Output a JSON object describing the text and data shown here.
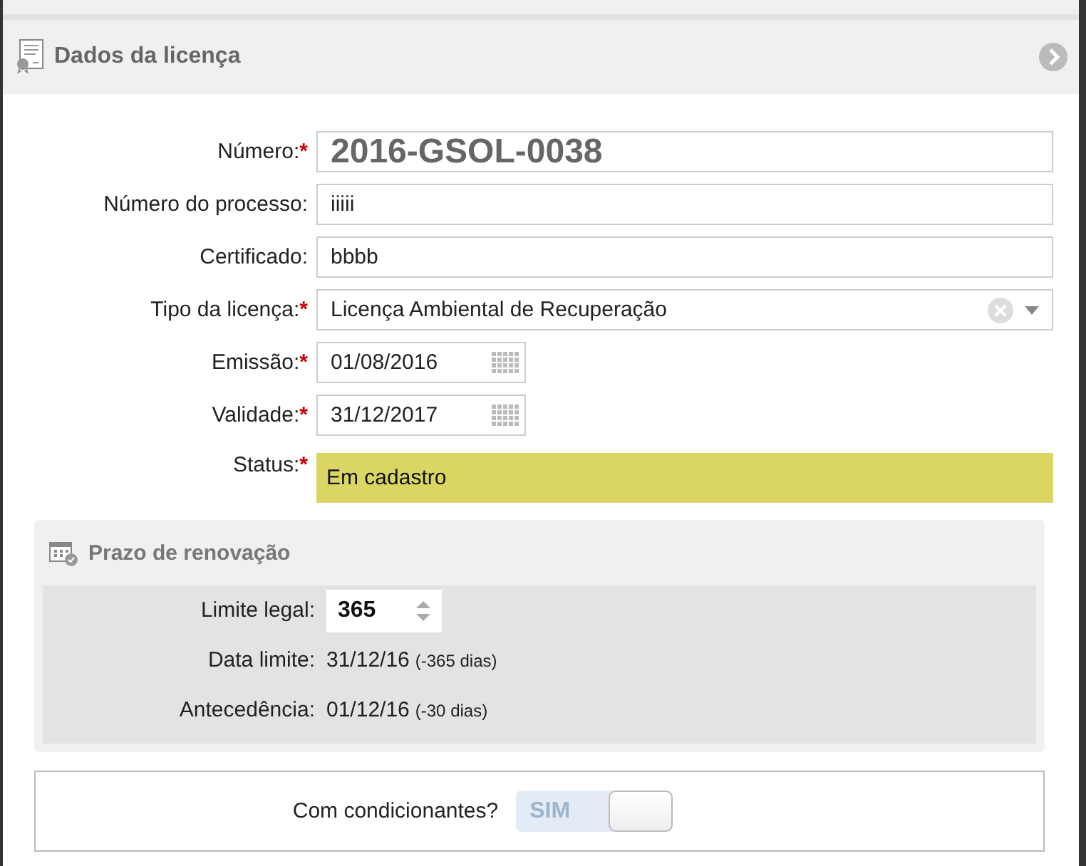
{
  "panel": {
    "title": "Dados da licença"
  },
  "fields": [
    {
      "kind": "text",
      "label": "Número:",
      "required": true,
      "value": "2016-GSOL-0038",
      "emphasis": true
    },
    {
      "kind": "text",
      "label": "Número do processo:",
      "required": false,
      "value": "iiiii"
    },
    {
      "kind": "text",
      "label": "Certificado:",
      "required": false,
      "value": "bbbb"
    },
    {
      "kind": "select",
      "label": "Tipo da licença:",
      "required": true,
      "value": "Licença Ambiental de Recuperação"
    },
    {
      "kind": "date",
      "label": "Emissão:",
      "required": true,
      "value": "01/08/2016"
    },
    {
      "kind": "date",
      "label": "Validade:",
      "required": true,
      "value": "31/12/2017"
    },
    {
      "kind": "status",
      "label": "Status:",
      "required": true,
      "value": "Em cadastro",
      "color": "#dbd564"
    }
  ],
  "renewal": {
    "title": "Prazo de renovação",
    "limit": {
      "label": "Limite legal:",
      "value": "365"
    },
    "rows": [
      {
        "label": "Data limite:",
        "value": "31/12/16",
        "note": "(-365 dias)"
      },
      {
        "label": "Antecedência:",
        "value": "01/12/16",
        "note": "(-30 dias)"
      }
    ]
  },
  "conditions": {
    "label": "Com condicionantes?",
    "toggle": {
      "text": "SIM",
      "on": true
    }
  },
  "required_mark": "*"
}
